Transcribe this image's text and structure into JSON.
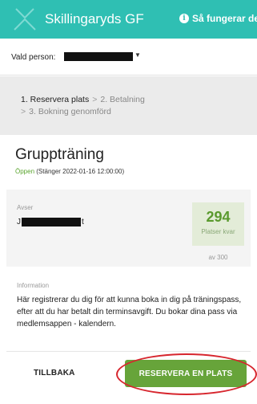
{
  "header": {
    "title": "Skillingaryds GF",
    "help_label": "Så fungerar det",
    "logo_icon": "club-logo-icon",
    "info_icon": "info-icon",
    "color": "#2fbfb3"
  },
  "person": {
    "label": "Vald person:",
    "selected_value": "[redacted]",
    "dropdown_icon": "caret-down-icon"
  },
  "steps": {
    "step1": "1. Reservera plats",
    "separator1": ">",
    "step2": "2. Betalning",
    "separator2": ">",
    "step3": "3. Bokning genomförd"
  },
  "card": {
    "title": "Gruppträning",
    "status_open": "Öppen",
    "status_closes": "(Stänger 2022-01-16 12:00:00)",
    "avser_label": "Avser",
    "avser_name_start": "J",
    "avser_name_end": "t",
    "places_count": "294",
    "places_label": "Platser kvar",
    "places_total": "av 300",
    "info_label": "Information",
    "info_text": "Här registrerar du dig för att kunna boka in dig på träningspass, efter att du har betalt din terminsavgift. Du bokar dina pass via medlemsappen - kalendern."
  },
  "actions": {
    "back_label": "TILLBAKA",
    "reserve_label": "RESERVERA EN PLATS",
    "reserve_color": "#67a43a",
    "highlight_color": "#d7262e"
  }
}
